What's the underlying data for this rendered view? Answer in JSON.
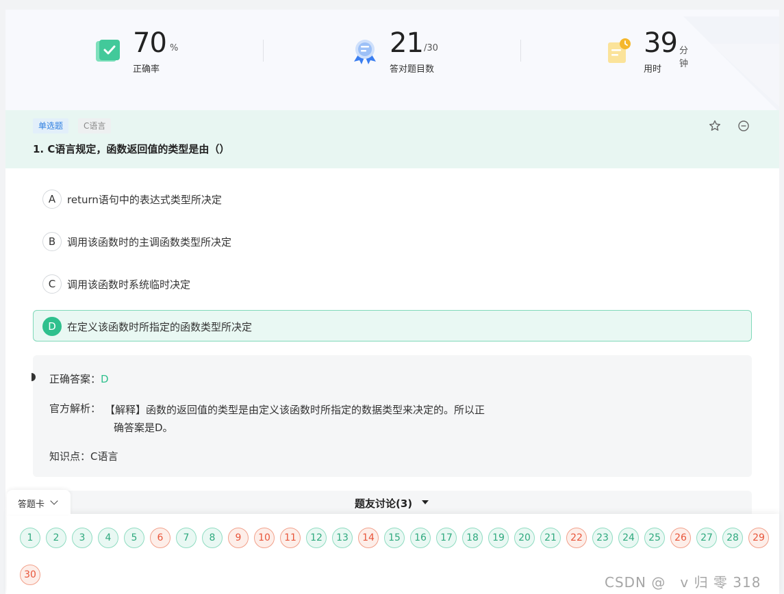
{
  "stats": [
    {
      "value": "70",
      "unit": "%",
      "label": "正确率",
      "icon": "check-card-icon"
    },
    {
      "value": "21",
      "unit": "/30",
      "label": "答对题目数",
      "icon": "award-ribbon-icon"
    },
    {
      "value": "39",
      "unit": "分钟",
      "label": "用时",
      "icon": "notepad-clock-icon"
    }
  ],
  "question": {
    "type_tag": "单选题",
    "subject_tag": "C语言",
    "title": "1. C语言规定，函数返回值的类型是由（）",
    "options": [
      {
        "letter": "A",
        "text": "return语句中的表达式类型所决定",
        "selected": false
      },
      {
        "letter": "B",
        "text": "调用该函数时的主调函数类型所决定",
        "selected": false
      },
      {
        "letter": "C",
        "text": "调用该函数时系统临时决定",
        "selected": false
      },
      {
        "letter": "D",
        "text": "在定义该函数时所指定的函数类型所决定",
        "selected": true
      }
    ]
  },
  "analysis": {
    "answer_label": "正确答案：",
    "answer_value": "D",
    "explain_label": "官方解析：",
    "explain_line1": "【解释】函数的返回值的类型是由定义该函数时所指定的数据类型来决定的。所以正",
    "explain_line2": "确答案是D。",
    "knowledge_label": "知识点：",
    "knowledge_value": "C语言"
  },
  "discussion": {
    "label": "题友讨论(3)"
  },
  "answer_card": {
    "tab_label": "答题卡",
    "numbers": [
      {
        "n": "1",
        "status": "right"
      },
      {
        "n": "2",
        "status": "right"
      },
      {
        "n": "3",
        "status": "right"
      },
      {
        "n": "4",
        "status": "right"
      },
      {
        "n": "5",
        "status": "right"
      },
      {
        "n": "6",
        "status": "wrong"
      },
      {
        "n": "7",
        "status": "right"
      },
      {
        "n": "8",
        "status": "right"
      },
      {
        "n": "9",
        "status": "wrong"
      },
      {
        "n": "10",
        "status": "wrong"
      },
      {
        "n": "11",
        "status": "wrong"
      },
      {
        "n": "12",
        "status": "right"
      },
      {
        "n": "13",
        "status": "right"
      },
      {
        "n": "14",
        "status": "wrong"
      },
      {
        "n": "15",
        "status": "right"
      },
      {
        "n": "16",
        "status": "right"
      },
      {
        "n": "17",
        "status": "right"
      },
      {
        "n": "18",
        "status": "right"
      },
      {
        "n": "19",
        "status": "right"
      },
      {
        "n": "20",
        "status": "right"
      },
      {
        "n": "21",
        "status": "right"
      },
      {
        "n": "22",
        "status": "wrong"
      },
      {
        "n": "23",
        "status": "right"
      },
      {
        "n": "24",
        "status": "right"
      },
      {
        "n": "25",
        "status": "right"
      },
      {
        "n": "26",
        "status": "wrong"
      },
      {
        "n": "27",
        "status": "right"
      },
      {
        "n": "28",
        "status": "right"
      },
      {
        "n": "29",
        "status": "wrong"
      },
      {
        "n": "30",
        "status": "wrong"
      }
    ]
  },
  "watermark": "CSDN @　v 归 零 318",
  "colors": {
    "correct": "#2fc08d",
    "wrong": "#e8553a",
    "tag_blue": "#2f7fe0"
  }
}
